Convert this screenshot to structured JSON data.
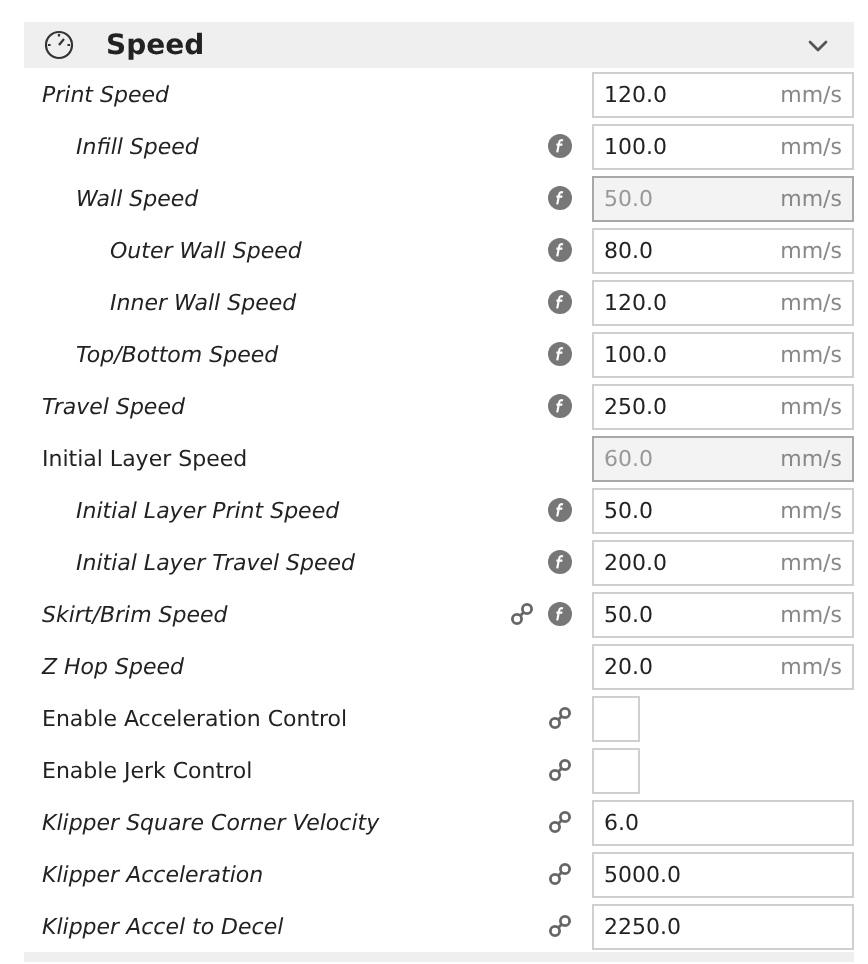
{
  "section": {
    "title": "Speed",
    "expanded": true
  },
  "settings": [
    {
      "label": "Print Speed",
      "kind": "number",
      "modified": true,
      "linked": false,
      "formula": false,
      "disabled": false,
      "value": "120.0",
      "unit": "mm/s",
      "children": [
        {
          "label": "Infill Speed",
          "kind": "number",
          "modified": true,
          "linked": false,
          "formula": true,
          "disabled": false,
          "value": "100.0",
          "unit": "mm/s"
        },
        {
          "label": "Wall Speed",
          "kind": "number",
          "modified": true,
          "linked": false,
          "formula": true,
          "disabled": true,
          "value": "50.0",
          "unit": "mm/s",
          "children": [
            {
              "label": "Outer Wall Speed",
              "kind": "number",
              "modified": true,
              "linked": false,
              "formula": true,
              "disabled": false,
              "value": "80.0",
              "unit": "mm/s"
            },
            {
              "label": "Inner Wall Speed",
              "kind": "number",
              "modified": true,
              "linked": false,
              "formula": true,
              "disabled": false,
              "value": "120.0",
              "unit": "mm/s"
            }
          ]
        },
        {
          "label": "Top/Bottom Speed",
          "kind": "number",
          "modified": true,
          "linked": false,
          "formula": true,
          "disabled": false,
          "value": "100.0",
          "unit": "mm/s"
        }
      ]
    },
    {
      "label": "Travel Speed",
      "kind": "number",
      "modified": true,
      "linked": false,
      "formula": true,
      "disabled": false,
      "value": "250.0",
      "unit": "mm/s"
    },
    {
      "label": "Initial Layer Speed",
      "kind": "number",
      "modified": false,
      "linked": false,
      "formula": false,
      "disabled": true,
      "value": "60.0",
      "unit": "mm/s",
      "children": [
        {
          "label": "Initial Layer Print Speed",
          "kind": "number",
          "modified": true,
          "linked": false,
          "formula": true,
          "disabled": false,
          "value": "50.0",
          "unit": "mm/s"
        },
        {
          "label": "Initial Layer Travel Speed",
          "kind": "number",
          "modified": true,
          "linked": false,
          "formula": true,
          "disabled": false,
          "value": "200.0",
          "unit": "mm/s"
        }
      ]
    },
    {
      "label": "Skirt/Brim Speed",
      "kind": "number",
      "modified": true,
      "linked": true,
      "formula": true,
      "disabled": false,
      "value": "50.0",
      "unit": "mm/s"
    },
    {
      "label": "Z Hop Speed",
      "kind": "number",
      "modified": true,
      "linked": false,
      "formula": false,
      "disabled": false,
      "value": "20.0",
      "unit": "mm/s"
    },
    {
      "label": "Enable Acceleration Control",
      "kind": "checkbox",
      "modified": false,
      "linked": true,
      "formula": false,
      "checked": false
    },
    {
      "label": "Enable Jerk Control",
      "kind": "checkbox",
      "modified": false,
      "linked": true,
      "formula": false,
      "checked": false
    },
    {
      "label": "Klipper Square Corner Velocity",
      "kind": "number",
      "modified": true,
      "linked": true,
      "formula": false,
      "disabled": false,
      "value": "6.0"
    },
    {
      "label": "Klipper Acceleration",
      "kind": "number",
      "modified": true,
      "linked": true,
      "formula": false,
      "disabled": false,
      "value": "5000.0"
    },
    {
      "label": "Klipper Accel to Decel",
      "kind": "number",
      "modified": true,
      "linked": true,
      "formula": false,
      "disabled": false,
      "value": "2250.0"
    }
  ]
}
